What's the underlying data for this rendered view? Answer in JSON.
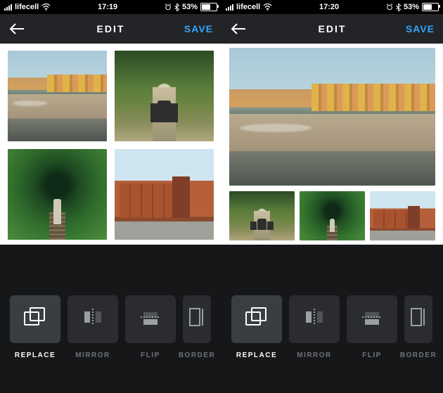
{
  "left": {
    "status": {
      "carrier": "lifecell",
      "time": "17:19",
      "battery_pct": "53%"
    },
    "nav": {
      "title": "EDIT",
      "save": "SAVE"
    },
    "tools": [
      {
        "key": "replace",
        "label": "REPLACE",
        "active": true
      },
      {
        "key": "mirror",
        "label": "MIRROR",
        "active": false
      },
      {
        "key": "flip",
        "label": "FLIP",
        "active": false
      },
      {
        "key": "border",
        "label": "BORDER",
        "active": false
      }
    ],
    "grid": {
      "tl": {
        "name": "photo-cityscape-river"
      },
      "tr": {
        "name": "photo-people-tree-path"
      },
      "bl": {
        "name": "photo-green-tunnel-person"
      },
      "br": {
        "name": "photo-brick-building-street"
      }
    }
  },
  "right": {
    "status": {
      "carrier": "lifecell",
      "time": "17:20",
      "battery_pct": "53%"
    },
    "nav": {
      "title": "EDIT",
      "save": "SAVE"
    },
    "tools": [
      {
        "key": "replace",
        "label": "REPLACE",
        "active": true
      },
      {
        "key": "mirror",
        "label": "MIRROR",
        "active": false
      },
      {
        "key": "flip",
        "label": "FLIP",
        "active": false
      },
      {
        "key": "border",
        "label": "BORDER",
        "active": false
      }
    ],
    "layout": {
      "hero": {
        "name": "photo-cityscape-river"
      },
      "small": [
        {
          "name": "photo-people-tree-path"
        },
        {
          "name": "photo-green-tunnel-person"
        },
        {
          "name": "photo-brick-building-street"
        }
      ]
    }
  },
  "colors": {
    "accent": "#36a4ff",
    "chrome": "#222427",
    "tray": "#161719"
  }
}
